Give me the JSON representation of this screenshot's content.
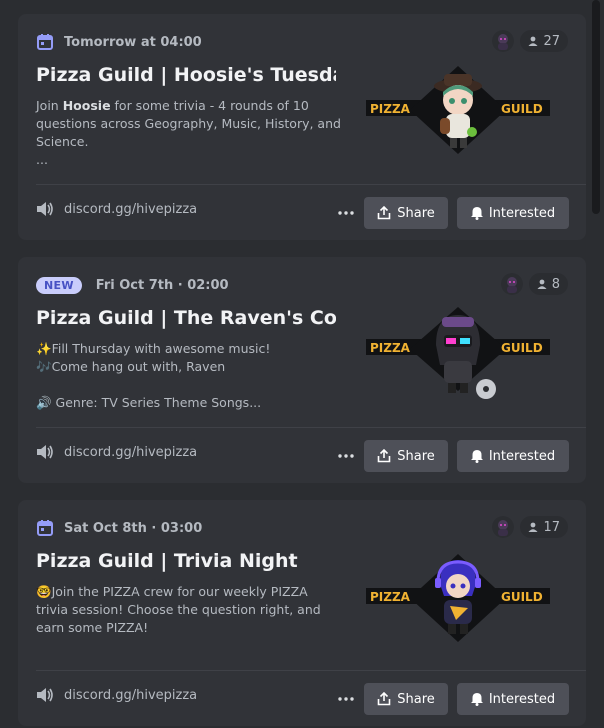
{
  "colors": {
    "accent_banner_text": "#f0b232",
    "calendar_icon": "#949cf7",
    "new_badge_bg": "#c9cdfb",
    "new_badge_text": "#4752c4",
    "button_bg": "#4e5058"
  },
  "events": [
    {
      "date_icon": "calendar-icon",
      "date": "Tomorrow at 04:00",
      "interested_count": "27",
      "title": "Pizza Guild | Hoosie's Tuesda...",
      "description": {
        "prefix": "Join ",
        "host": "Hoosie",
        "line1_suffix": " for some trivia - 4 rounds of 10",
        "line2": "questions across Geography, Music, History, and",
        "line3": "Science.",
        "line4": "..."
      },
      "banner": {
        "left": "PIZZA",
        "right": "GUILD"
      },
      "location": "discord.gg/hivepizza",
      "share_label": "Share",
      "interested_label": "Interested"
    },
    {
      "badge": "NEW",
      "date": "Fri Oct 7th · 02:00",
      "interested_count": "8",
      "title": "Pizza Guild | The Raven's Court",
      "description": {
        "line1": "✨Fill Thursday with awesome music!",
        "line2": "🎶Come hang out with, Raven",
        "line3": "🔊 Genre: TV Series Theme Songs..."
      },
      "banner": {
        "left": "PIZZA",
        "right": "GUILD"
      },
      "location": "discord.gg/hivepizza",
      "share_label": "Share",
      "interested_label": "Interested"
    },
    {
      "date_icon": "calendar-icon",
      "date": "Sat Oct 8th · 03:00",
      "interested_count": "17",
      "title": "Pizza Guild | Trivia Night",
      "description": {
        "line1": "🤓Join the PIZZA crew for our weekly PIZZA",
        "line2": "trivia session! Choose the question right, and",
        "line3": "earn some PIZZA!"
      },
      "banner": {
        "left": "PIZZA",
        "right": "GUILD"
      },
      "location": "discord.gg/hivepizza",
      "share_label": "Share",
      "interested_label": "Interested"
    }
  ]
}
